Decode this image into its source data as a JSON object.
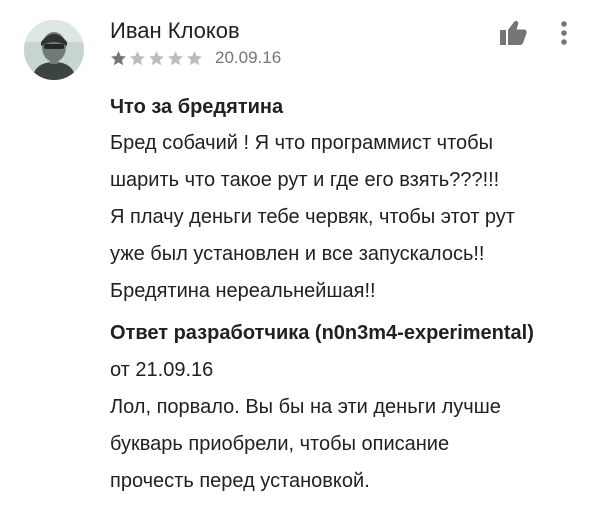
{
  "review": {
    "author": "Иван Клоков",
    "avatar_icon": "user-photo-avatar",
    "rating": 1,
    "rating_max": 5,
    "star_filled_color": "#757575",
    "star_empty_color": "#bdbdbd",
    "date": "20.09.16",
    "title": "Что за бредятина",
    "body_lines": [
      "Бред собачий ! Я что программист чтобы",
      "шарить что такое рут и где его взять???!!!",
      "Я плачу деньги тебе червяк, чтобы этот рут",
      "уже был установлен и все запускалось!!",
      "Бредятина нереальнейшая!!"
    ],
    "actions": {
      "helpful_icon": "thumbs-up-icon",
      "more_icon": "more-vert-icon"
    }
  },
  "developer_reply": {
    "header": "Ответ разработчика (n0n3m4-experimental)",
    "date": "от 21.09.16",
    "text_lines": [
      "Лол, порвало. Вы бы на эти деньги лучше",
      "букварь приобрели, чтобы описание",
      "прочесть перед установкой."
    ]
  }
}
